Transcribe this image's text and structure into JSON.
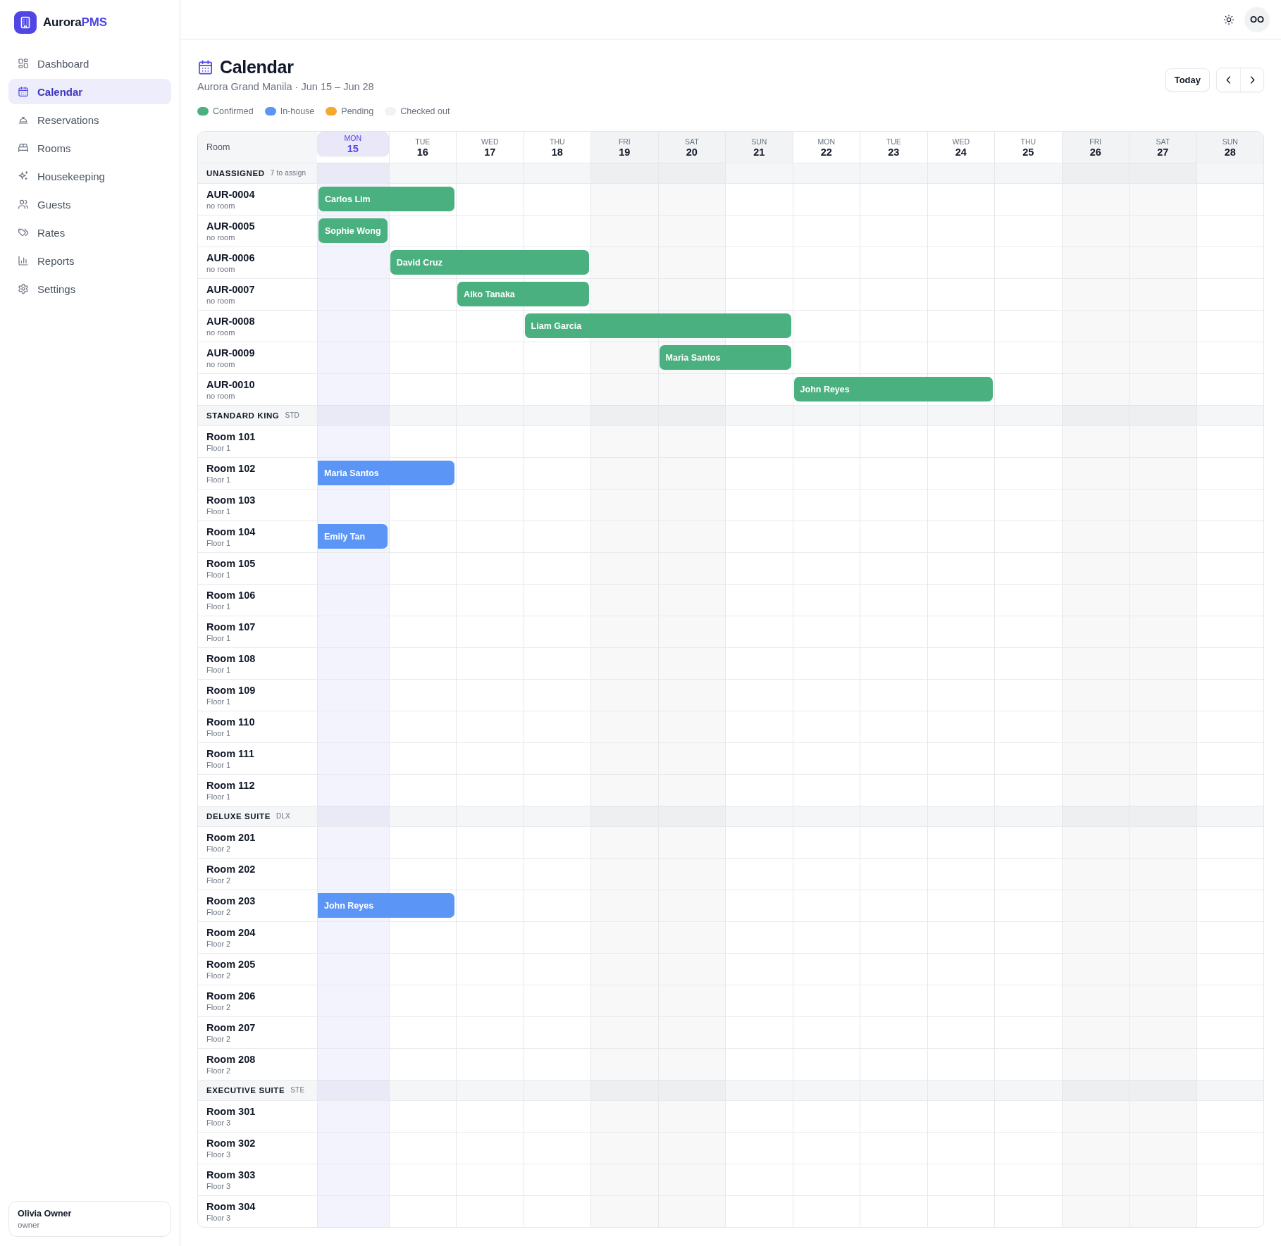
{
  "brand": {
    "name": "Aurora",
    "accent": "PMS"
  },
  "sidebar": {
    "items": [
      {
        "label": "Dashboard",
        "selected": false
      },
      {
        "label": "Calendar",
        "selected": true
      },
      {
        "label": "Reservations",
        "selected": false
      },
      {
        "label": "Rooms",
        "selected": false
      },
      {
        "label": "Housekeeping",
        "selected": false
      },
      {
        "label": "Guests",
        "selected": false
      },
      {
        "label": "Rates",
        "selected": false
      },
      {
        "label": "Reports",
        "selected": false
      },
      {
        "label": "Settings",
        "selected": false
      }
    ],
    "user": {
      "name": "Olivia Owner",
      "role": "owner"
    }
  },
  "topbar": {
    "avatar": "OO"
  },
  "page": {
    "title": "Calendar",
    "subtitle": "Aurora Grand Manila · Jun 15 – Jun 28",
    "today_button": "Today"
  },
  "legend": [
    {
      "label": "Confirmed",
      "color": "#4bb07f"
    },
    {
      "label": "In-house",
      "color": "#5b95f6"
    },
    {
      "label": "Pending",
      "color": "#f4a82e"
    },
    {
      "label": "Checked out",
      "color": "#f1f2f4"
    }
  ],
  "calendar": {
    "room_header": "Room",
    "days": [
      {
        "weekday": "MON",
        "date": "15",
        "today": true,
        "weekend": false,
        "weekend_night": false
      },
      {
        "weekday": "TUE",
        "date": "16",
        "today": false,
        "weekend": false,
        "weekend_night": false
      },
      {
        "weekday": "WED",
        "date": "17",
        "today": false,
        "weekend": false,
        "weekend_night": false
      },
      {
        "weekday": "THU",
        "date": "18",
        "today": false,
        "weekend": false,
        "weekend_night": false
      },
      {
        "weekday": "FRI",
        "date": "19",
        "today": false,
        "weekend": true,
        "weekend_night": true
      },
      {
        "weekday": "SAT",
        "date": "20",
        "today": false,
        "weekend": true,
        "weekend_night": true
      },
      {
        "weekday": "SUN",
        "date": "21",
        "today": false,
        "weekend": true,
        "weekend_night": false
      },
      {
        "weekday": "MON",
        "date": "22",
        "today": false,
        "weekend": false,
        "weekend_night": false
      },
      {
        "weekday": "TUE",
        "date": "23",
        "today": false,
        "weekend": false,
        "weekend_night": false
      },
      {
        "weekday": "WED",
        "date": "24",
        "today": false,
        "weekend": false,
        "weekend_night": false
      },
      {
        "weekday": "THU",
        "date": "25",
        "today": false,
        "weekend": false,
        "weekend_night": false
      },
      {
        "weekday": "FRI",
        "date": "26",
        "today": false,
        "weekend": true,
        "weekend_night": true
      },
      {
        "weekday": "SAT",
        "date": "27",
        "today": false,
        "weekend": true,
        "weekend_night": true
      },
      {
        "weekday": "SUN",
        "date": "28",
        "today": false,
        "weekend": true,
        "weekend_night": false
      }
    ],
    "groups": [
      {
        "name": "UNASSIGNED",
        "tag": "7 to assign",
        "rows": [
          {
            "name": "AUR-0004",
            "detail": "no room",
            "bookings": [
              {
                "guest": "Carlos Lim",
                "color": "#4bb07f",
                "continues_before": false,
                "on_days": [
                  true,
                  true,
                  false,
                  false,
                  false,
                  false,
                  false,
                  false,
                  false,
                  false,
                  false,
                  false,
                  false,
                  false
                ]
              }
            ]
          },
          {
            "name": "AUR-0005",
            "detail": "no room",
            "bookings": [
              {
                "guest": "Sophie Wong",
                "color": "#4bb07f",
                "continues_before": false,
                "on_days": [
                  true,
                  false,
                  false,
                  false,
                  false,
                  false,
                  false,
                  false,
                  false,
                  false,
                  false,
                  false,
                  false,
                  false
                ]
              }
            ]
          },
          {
            "name": "AUR-0006",
            "detail": "no room",
            "bookings": [
              {
                "guest": "David Cruz",
                "color": "#4bb07f",
                "continues_before": false,
                "on_days": [
                  false,
                  true,
                  true,
                  true,
                  false,
                  false,
                  false,
                  false,
                  false,
                  false,
                  false,
                  false,
                  false,
                  false
                ]
              }
            ]
          },
          {
            "name": "AUR-0007",
            "detail": "no room",
            "bookings": [
              {
                "guest": "Aiko Tanaka",
                "color": "#4bb07f",
                "continues_before": false,
                "on_days": [
                  false,
                  false,
                  true,
                  true,
                  false,
                  false,
                  false,
                  false,
                  false,
                  false,
                  false,
                  false,
                  false,
                  false
                ]
              }
            ]
          },
          {
            "name": "AUR-0008",
            "detail": "no room",
            "bookings": [
              {
                "guest": "Liam Garcia",
                "color": "#4bb07f",
                "continues_before": false,
                "on_days": [
                  false,
                  false,
                  false,
                  true,
                  true,
                  true,
                  true,
                  false,
                  false,
                  false,
                  false,
                  false,
                  false,
                  false
                ]
              }
            ]
          },
          {
            "name": "AUR-0009",
            "detail": "no room",
            "bookings": [
              {
                "guest": "Maria Santos",
                "color": "#4bb07f",
                "continues_before": false,
                "on_days": [
                  false,
                  false,
                  false,
                  false,
                  false,
                  true,
                  true,
                  false,
                  false,
                  false,
                  false,
                  false,
                  false,
                  false
                ]
              }
            ]
          },
          {
            "name": "AUR-0010",
            "detail": "no room",
            "bookings": [
              {
                "guest": "John Reyes",
                "color": "#4bb07f",
                "continues_before": false,
                "on_days": [
                  false,
                  false,
                  false,
                  false,
                  false,
                  false,
                  false,
                  true,
                  true,
                  true,
                  false,
                  false,
                  false,
                  false
                ]
              }
            ]
          }
        ]
      },
      {
        "name": "STANDARD KING",
        "tag": "STD",
        "rows": [
          {
            "name": "Room 101",
            "detail": "Floor 1"
          },
          {
            "name": "Room 102",
            "detail": "Floor 1",
            "bookings": [
              {
                "guest": "Maria Santos",
                "color": "#5b95f6",
                "continues_before": true,
                "on_days": [
                  true,
                  true,
                  false,
                  false,
                  false,
                  false,
                  false,
                  false,
                  false,
                  false,
                  false,
                  false,
                  false,
                  false
                ]
              }
            ]
          },
          {
            "name": "Room 103",
            "detail": "Floor 1"
          },
          {
            "name": "Room 104",
            "detail": "Floor 1",
            "bookings": [
              {
                "guest": "Emily Tan",
                "color": "#5b95f6",
                "continues_before": true,
                "on_days": [
                  true,
                  false,
                  false,
                  false,
                  false,
                  false,
                  false,
                  false,
                  false,
                  false,
                  false,
                  false,
                  false,
                  false
                ]
              }
            ]
          },
          {
            "name": "Room 105",
            "detail": "Floor 1"
          },
          {
            "name": "Room 106",
            "detail": "Floor 1"
          },
          {
            "name": "Room 107",
            "detail": "Floor 1"
          },
          {
            "name": "Room 108",
            "detail": "Floor 1"
          },
          {
            "name": "Room 109",
            "detail": "Floor 1"
          },
          {
            "name": "Room 110",
            "detail": "Floor 1"
          },
          {
            "name": "Room 111",
            "detail": "Floor 1"
          },
          {
            "name": "Room 112",
            "detail": "Floor 1"
          }
        ]
      },
      {
        "name": "DELUXE SUITE",
        "tag": "DLX",
        "rows": [
          {
            "name": "Room 201",
            "detail": "Floor 2"
          },
          {
            "name": "Room 202",
            "detail": "Floor 2"
          },
          {
            "name": "Room 203",
            "detail": "Floor 2",
            "bookings": [
              {
                "guest": "John Reyes",
                "color": "#5b95f6",
                "continues_before": true,
                "on_days": [
                  true,
                  true,
                  false,
                  false,
                  false,
                  false,
                  false,
                  false,
                  false,
                  false,
                  false,
                  false,
                  false,
                  false
                ]
              }
            ]
          },
          {
            "name": "Room 204",
            "detail": "Floor 2"
          },
          {
            "name": "Room 205",
            "detail": "Floor 2"
          },
          {
            "name": "Room 206",
            "detail": "Floor 2"
          },
          {
            "name": "Room 207",
            "detail": "Floor 2"
          },
          {
            "name": "Room 208",
            "detail": "Floor 2"
          }
        ]
      },
      {
        "name": "EXECUTIVE SUITE",
        "tag": "STE",
        "rows": [
          {
            "name": "Room 301",
            "detail": "Floor 3"
          },
          {
            "name": "Room 302",
            "detail": "Floor 3"
          },
          {
            "name": "Room 303",
            "detail": "Floor 3"
          },
          {
            "name": "Room 304",
            "detail": "Floor 3"
          }
        ]
      }
    ]
  }
}
